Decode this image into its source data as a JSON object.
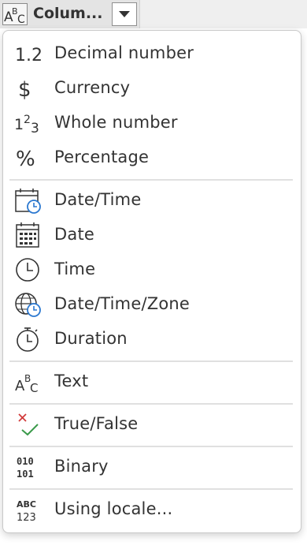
{
  "header": {
    "column_title": "Colum...",
    "type_icon": "abc-text-type-icon",
    "dropdown_icon": "triangle-down-icon"
  },
  "menu": {
    "items": [
      {
        "label": "Decimal number",
        "icon": "decimal-icon"
      },
      {
        "label": "Currency",
        "icon": "currency-icon"
      },
      {
        "label": "Whole number",
        "icon": "whole-number-icon"
      },
      {
        "label": "Percentage",
        "icon": "percentage-icon"
      },
      {
        "label": "Date/Time",
        "icon": "datetime-icon"
      },
      {
        "label": "Date",
        "icon": "date-icon"
      },
      {
        "label": "Time",
        "icon": "time-icon"
      },
      {
        "label": "Date/Time/Zone",
        "icon": "datetimezone-icon"
      },
      {
        "label": "Duration",
        "icon": "duration-icon"
      },
      {
        "label": "Text",
        "icon": "text-icon"
      },
      {
        "label": "True/False",
        "icon": "true-false-icon"
      },
      {
        "label": "Binary",
        "icon": "binary-icon"
      },
      {
        "label": "Using locale...",
        "icon": "locale-icon"
      }
    ]
  },
  "colors": {
    "accent_blue": "#2b78d0",
    "check_green": "#3a9a4a",
    "cross_red": "#d23b3b",
    "text": "#333333"
  }
}
